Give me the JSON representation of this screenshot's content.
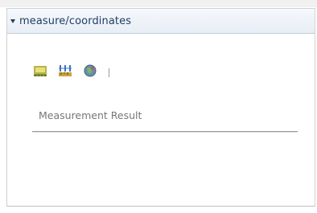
{
  "panel": {
    "title": "measure/coordinates",
    "expanded": true
  },
  "toolbar": {
    "tools": [
      {
        "name": "area-measure-icon"
      },
      {
        "name": "distance-measure-icon"
      },
      {
        "name": "location-coordinates-icon"
      }
    ]
  },
  "result": {
    "label": "Measurement Result"
  }
}
